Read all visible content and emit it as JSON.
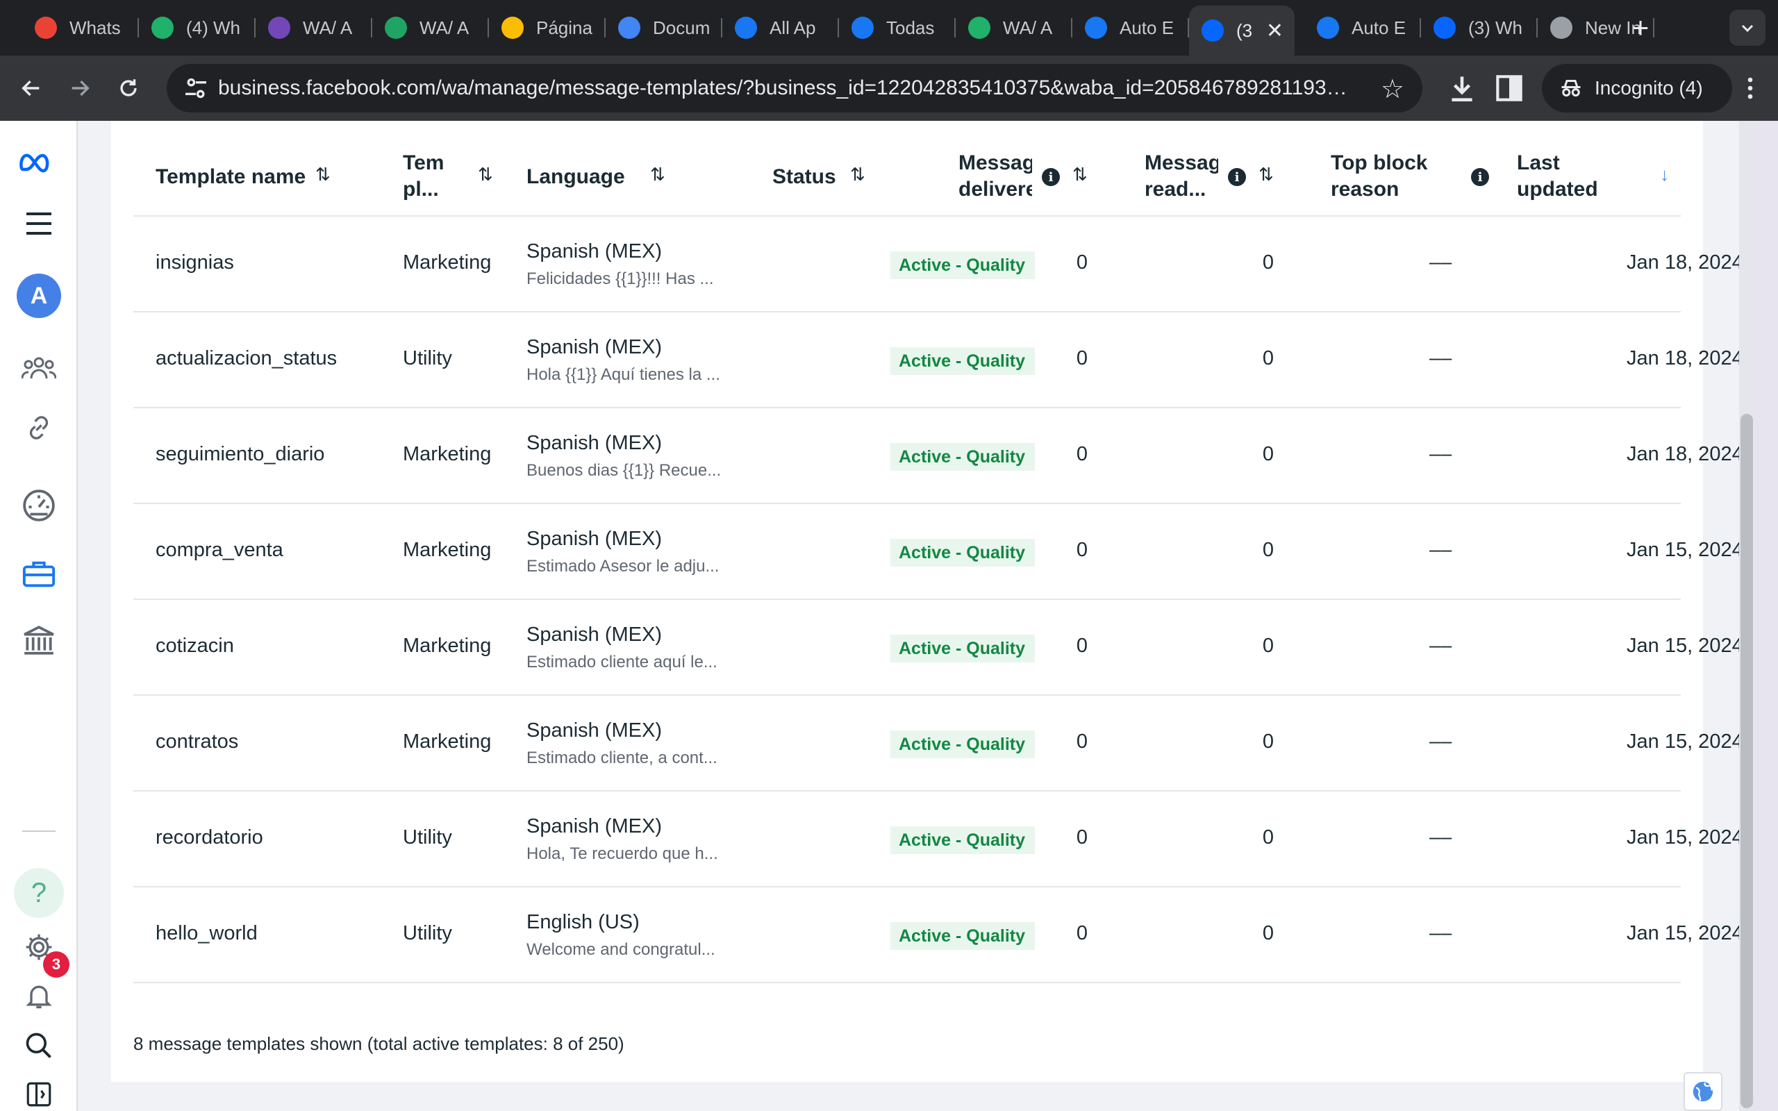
{
  "browser": {
    "tabs": [
      {
        "label": "Whats",
        "icon": "gmail-icon",
        "color": "#ea4335"
      },
      {
        "label": "(4) Wh",
        "icon": "pabbly-icon",
        "color": "#20b16a"
      },
      {
        "label": "WA/ A",
        "icon": "forms-icon",
        "color": "#7248b9"
      },
      {
        "label": "WA/ A",
        "icon": "sheets-icon",
        "color": "#1fa463"
      },
      {
        "label": "Página",
        "icon": "drive-icon",
        "color": "#fbbc04"
      },
      {
        "label": "Docum",
        "icon": "docs-icon",
        "color": "#4285f4"
      },
      {
        "label": "All Ap",
        "icon": "facebook-icon",
        "color": "#1877f2"
      },
      {
        "label": "Todas",
        "icon": "facebook-icon",
        "color": "#1877f2"
      },
      {
        "label": "WA/ A",
        "icon": "pabbly-icon",
        "color": "#20b16a"
      },
      {
        "label": "Auto E",
        "icon": "facebook-icon",
        "color": "#1877f2"
      },
      {
        "label": "(3",
        "icon": "meta-icon",
        "color": "#0866ff",
        "active": true
      },
      {
        "label": "Auto E",
        "icon": "facebook-icon",
        "color": "#1877f2"
      },
      {
        "label": "(3) Wh",
        "icon": "meta-icon",
        "color": "#0866ff"
      },
      {
        "label": "New In",
        "icon": "incognito-icon",
        "color": "#9aa0a6"
      }
    ],
    "close_glyph": "✕",
    "new_tab_glyph": "+",
    "url": "business.facebook.com/wa/manage/message-templates/?business_id=122042835410375&waba_id=205846789281193&fil...",
    "incognito_label": "Incognito (4)"
  },
  "table": {
    "headers": {
      "name": "Template name",
      "category_line1": "Tem",
      "category_line2": "pl...",
      "language": "Language",
      "status": "Status",
      "delivered_line1": "Messag",
      "delivered_line2": "delivere",
      "read_line1": "Messag",
      "read_line2": "read...",
      "block_line1": "Top block",
      "block_line2": "reason",
      "updated_line1": "Last",
      "updated_line2": "updated"
    },
    "rows": [
      {
        "name": "insignias",
        "category": "Marketing",
        "language": "Spanish (MEX)",
        "preview": "Felicidades {{1}}!!! Has ...",
        "status": "Active - Quality",
        "delivered": "0",
        "read": "0",
        "block": "––",
        "updated": "Jan 18, 2024"
      },
      {
        "name": "actualizacion_status",
        "category": "Utility",
        "language": "Spanish (MEX)",
        "preview": "Hola {{1}} Aquí tienes la ...",
        "status": "Active - Quality",
        "delivered": "0",
        "read": "0",
        "block": "––",
        "updated": "Jan 18, 2024"
      },
      {
        "name": "seguimiento_diario",
        "category": "Marketing",
        "language": "Spanish (MEX)",
        "preview": "Buenos dias {{1}} Recue...",
        "status": "Active - Quality",
        "delivered": "0",
        "read": "0",
        "block": "––",
        "updated": "Jan 18, 2024"
      },
      {
        "name": "compra_venta",
        "category": "Marketing",
        "language": "Spanish (MEX)",
        "preview": "Estimado Asesor le adju...",
        "status": "Active - Quality",
        "delivered": "0",
        "read": "0",
        "block": "––",
        "updated": "Jan 15, 2024"
      },
      {
        "name": "cotizacin",
        "category": "Marketing",
        "language": "Spanish (MEX)",
        "preview": "Estimado cliente aquí le...",
        "status": "Active - Quality",
        "delivered": "0",
        "read": "0",
        "block": "––",
        "updated": "Jan 15, 2024"
      },
      {
        "name": "contratos",
        "category": "Marketing",
        "language": "Spanish (MEX)",
        "preview": "Estimado cliente, a cont...",
        "status": "Active - Quality",
        "delivered": "0",
        "read": "0",
        "block": "––",
        "updated": "Jan 15, 2024"
      },
      {
        "name": "recordatorio",
        "category": "Utility",
        "language": "Spanish (MEX)",
        "preview": "Hola, Te recuerdo que h...",
        "status": "Active - Quality",
        "delivered": "0",
        "read": "0",
        "block": "––",
        "updated": "Jan 15, 2024"
      },
      {
        "name": "hello_world",
        "category": "Utility",
        "language": "English (US)",
        "preview": "Welcome and congratul...",
        "status": "Active - Quality",
        "delivered": "0",
        "read": "0",
        "block": "––",
        "updated": "Jan 15, 2024"
      }
    ],
    "footer": "8 message templates shown (total active templates: 8 of 250)"
  },
  "sidebar": {
    "avatar_letter": "A",
    "help_glyph": "?",
    "notification_count": "3"
  },
  "colors": {
    "status_bg": "#e9f6ee",
    "status_text": "#128842",
    "accent": "#4a8ee8"
  }
}
